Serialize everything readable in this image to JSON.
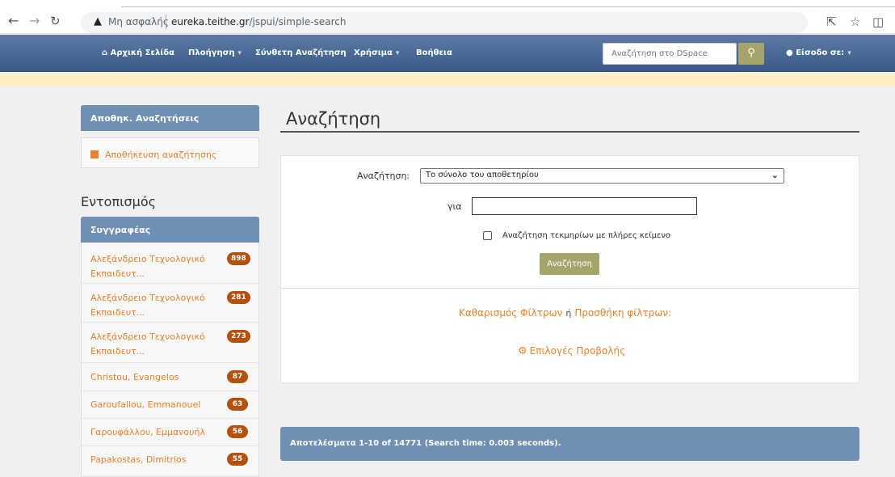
{
  "browser": {
    "insecure_label": "Μη ασφαλής",
    "host": "eureka.teithe.gr",
    "path": "/jspui/simple-search"
  },
  "navbar": {
    "home": "Αρχική Σελίδα",
    "browse": "Πλοήγηση",
    "advanced_search": "Σύνθετη Αναζήτηση",
    "tools": "Χρήσιμα",
    "help": "Βοήθεια",
    "search_placeholder": "Αναζήτηση στο DSpace",
    "login": "Είσοδο σε:"
  },
  "sidebar": {
    "saved_searches_title": "Αποθηκ. Αναζητήσεις",
    "save_search_link": "Αποθήκευση αναζήτησης",
    "locate_title": "Εντοπισμός",
    "author_facet_title": "Συγγραφέας",
    "authors": [
      {
        "name": "Αλεξάνδρειο Τεχνολογικό Εκπαιδευτ...",
        "count": "898"
      },
      {
        "name": "Αλεξάνδρειο Τεχνολογικό Εκπαιδευτ...",
        "count": "281"
      },
      {
        "name": "Αλεξάνδρειο Τεχνολογικό Εκπαιδευτ...",
        "count": "273"
      },
      {
        "name": "Christou, Evangelos",
        "count": "87"
      },
      {
        "name": "Garoufallou, Emmanouel",
        "count": "63"
      },
      {
        "name": "Γαρουφάλλου, Εμμανουήλ",
        "count": "56"
      },
      {
        "name": "Papakostas, Dimitrios",
        "count": "55"
      }
    ]
  },
  "main": {
    "title": "Αναζήτηση",
    "scope_label": "Αναζήτηση:",
    "scope_value": "Το σύνολο του αποθετηρίου",
    "query_label": "για",
    "fulltext_label": "Αναζήτηση τεκμηρίων με πλήρες κείμενο",
    "submit_label": "Αναζήτηση",
    "clear_filters": "Καθαρισμός Φίλτρων",
    "or_text": "ή",
    "add_filters": "Προσθήκη φίλτρων:",
    "view_options": "Επιλογές Προβολής",
    "results_summary": "Αποτελέσματα 1-10 of 14771 (Search time: 0.003 seconds)."
  }
}
